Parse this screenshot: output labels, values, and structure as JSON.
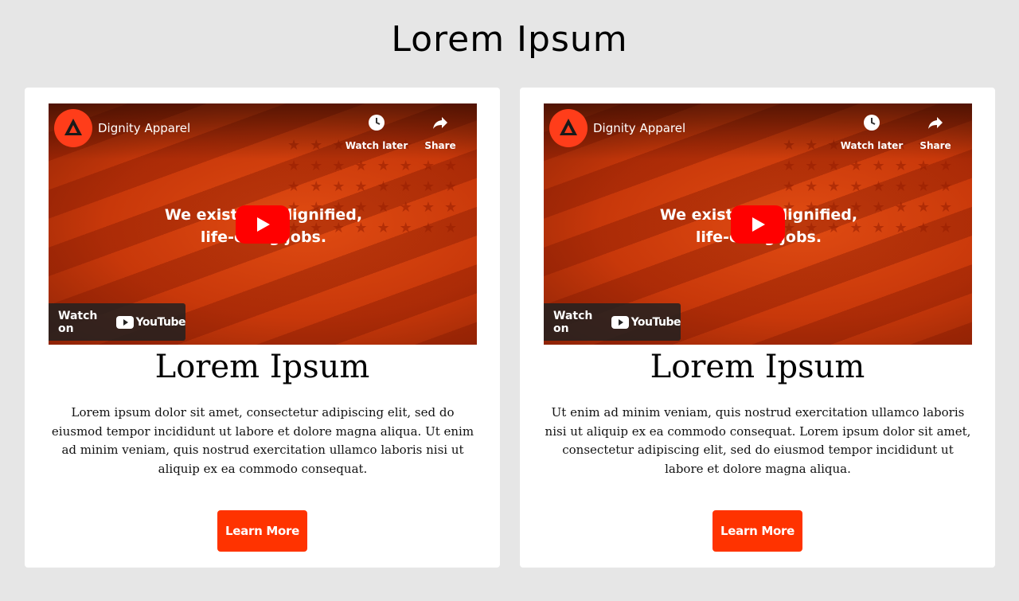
{
  "page": {
    "title": "Lorem Ipsum"
  },
  "colors": {
    "background": "#e6e6e6",
    "button": "#ff3300",
    "video_orange": "#d9410e",
    "youtube_red": "#ff0000"
  },
  "cards": [
    {
      "video": {
        "channel_name": "Dignity Apparel",
        "logo_text": "DIGNITY APPAREL",
        "watch_later_label": "Watch later",
        "share_label": "Share",
        "overlay_line1": "We exist to  e dignified,",
        "overlay_line2": "life-cha   g jobs.",
        "watch_on_label": "Watch on",
        "youtube_label": "YouTube",
        "icons": [
          "clock-icon",
          "share-icon",
          "play-icon",
          "youtube-logo-icon"
        ]
      },
      "title": "Lorem Ipsum",
      "body": "Lorem ipsum dolor sit amet, consectetur adipiscing elit, sed do eiusmod tempor incididunt ut labore et dolore magna aliqua. Ut enim ad minim veniam, quis nostrud exercitation ullamco laboris nisi ut aliquip ex ea commodo consequat.",
      "button_label": "Learn More"
    },
    {
      "video": {
        "channel_name": "Dignity Apparel",
        "logo_text": "DIGNITY APPAREL",
        "watch_later_label": "Watch later",
        "share_label": "Share",
        "overlay_line1": "We exist to  e dignified,",
        "overlay_line2": "life-cha   g jobs.",
        "watch_on_label": "Watch on",
        "youtube_label": "YouTube",
        "icons": [
          "clock-icon",
          "share-icon",
          "play-icon",
          "youtube-logo-icon"
        ]
      },
      "title": "Lorem Ipsum",
      "body": "Ut enim ad minim veniam, quis nostrud exercitation ullamco laboris nisi ut aliquip ex ea commodo consequat. Lorem ipsum dolor sit amet, consectetur adipiscing elit, sed do eiusmod tempor incididunt ut labore et dolore magna aliqua.",
      "button_label": "Learn More"
    }
  ]
}
